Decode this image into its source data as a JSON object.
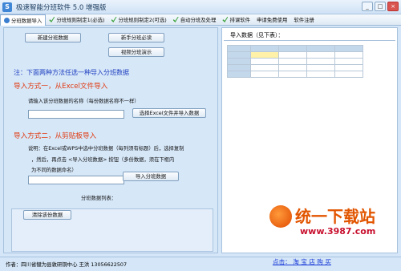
{
  "app": {
    "title": "极速智能分班软件 5.0 增强版"
  },
  "window_buttons": {
    "minimize": "_",
    "maximize": "□",
    "close": "×"
  },
  "toolbar": {
    "items": [
      {
        "label": "分班数据导入",
        "icon": "green-check-icon",
        "active": true
      },
      {
        "label": "分班规则制定1(必选)",
        "icon": "green-check-icon"
      },
      {
        "label": "分班规则制定2(可选)",
        "icon": "green-check-icon"
      },
      {
        "label": "自动分班及处理",
        "icon": "green-check-icon"
      },
      {
        "label": "排课软件",
        "icon": "green-check-icon"
      },
      {
        "label": "申请免费使用",
        "icon": ""
      },
      {
        "label": "软件注册",
        "icon": ""
      }
    ]
  },
  "left": {
    "btn_new": "新建分班数据",
    "btn_guide": "新手分班必读",
    "btn_video": "视频分班演示",
    "note": "注：下面两种方法任选一种导入分班数据",
    "method1": {
      "title": "导入方式一，从Excel文件导入",
      "prompt": "请输入该分班数据的名称（每份数据名称不一样）",
      "input_value": "",
      "button": "选择Excel文件并导入数据"
    },
    "method2": {
      "title": "导入方式二，从剪贴板导入",
      "line1": "说明：在Excel或WPS中选中分班数据（每列须有标题）后，选择复制",
      "line2": "，然后，再点击 <导入分班数据> 按钮（多份数据，须在下框内",
      "line3": "为不同的数据命名）",
      "input_value": "",
      "button": "导入分班数据"
    },
    "list_label": "分班数据列表：",
    "btn_clear": "清除该份数据"
  },
  "right": {
    "title": "导入数据（见下表）：",
    "link": "点击： 淘 宝 店 购 买"
  },
  "status": {
    "text": "作者：四川省犍为县敦研铜中心 王洪    13056622507"
  },
  "watermark": {
    "title": "统一下载站",
    "url": "www.3987.com"
  }
}
